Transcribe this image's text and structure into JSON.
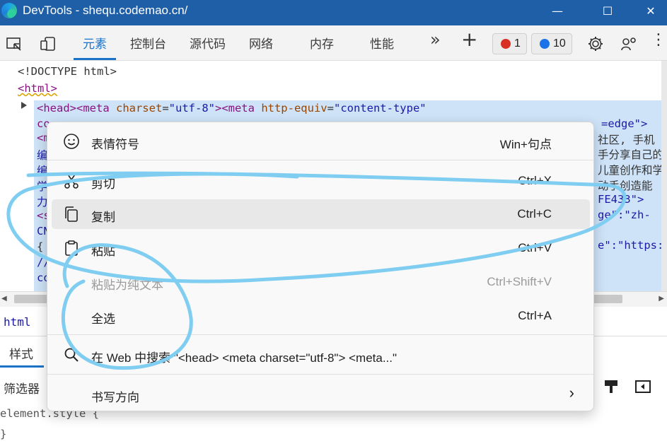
{
  "window": {
    "title": "DevTools - shequ.codemao.cn/",
    "minimize_glyph": "—",
    "maximize_glyph": "☐",
    "close_glyph": "✕"
  },
  "toolbar": {
    "tabs": [
      {
        "label": "元素",
        "active": true
      },
      {
        "label": "控制台",
        "active": false
      },
      {
        "label": "源代码",
        "active": false
      },
      {
        "label": "网络",
        "active": false
      },
      {
        "label": "内存",
        "active": false
      },
      {
        "label": "性能",
        "active": false
      }
    ],
    "more_glyph": "»",
    "add_glyph": "+",
    "error_count": "1",
    "message_count": "10",
    "ellipsis": "⋮",
    "colors": {
      "error": "#d93025",
      "message": "#1a73e8",
      "accent": "#1a73c8"
    }
  },
  "code": {
    "doctype": "<!DOCTYPE html>",
    "html_open": "<html>",
    "head_line": {
      "tag1": "<head><meta ",
      "attr1": "charset",
      "eq1": "=",
      "val1": "\"utf-8\"",
      "tag2": "><meta ",
      "attr2": "http-equiv",
      "eq2": "=",
      "val2": "\"content-type\""
    },
    "line2_right": "=edge\">",
    "right_fragments": [
      "社区, 手机",
      "手分享自己的",
      "儿童创作和学",
      "动手创造能",
      "FE433\">",
      "ge\":\"zh-",
      "e\":\"https:"
    ],
    "left_fragments": [
      "co",
      "<m",
      "编",
      "编",
      "学",
      "力",
      "<s",
      "CN",
      "{",
      "//",
      "co"
    ]
  },
  "bottom": {
    "crumb": "html",
    "styles_tab": "样式",
    "filter_placeholder": "筛选器",
    "style_rule": "element.style {",
    "style_close": "}"
  },
  "context_menu": {
    "items": [
      {
        "label": "表情符号",
        "shortcut": "Win+句点",
        "icon": "emoji-icon",
        "disabled": false
      },
      {
        "label": "剪切",
        "shortcut": "Ctrl+X",
        "icon": "scissors-icon",
        "disabled": false
      },
      {
        "label": "复制",
        "shortcut": "Ctrl+C",
        "icon": "copy-icon",
        "disabled": false,
        "hover": true
      },
      {
        "label": "粘贴",
        "shortcut": "Ctrl+V",
        "icon": "clipboard-icon",
        "disabled": false
      },
      {
        "label": "粘贴为纯文本",
        "shortcut": "Ctrl+Shift+V",
        "icon": "",
        "disabled": true
      },
      {
        "label": "全选",
        "shortcut": "Ctrl+A",
        "icon": "",
        "disabled": false
      },
      {
        "label": "在 Web 中搜索 \"<head> <meta charset=\"utf-8\"> <meta...\"",
        "shortcut": "",
        "icon": "search-icon",
        "disabled": false
      },
      {
        "label": "书写方向",
        "shortcut": "",
        "icon": "",
        "disabled": false,
        "submenu": true
      }
    ],
    "submenu_glyph": "›"
  }
}
